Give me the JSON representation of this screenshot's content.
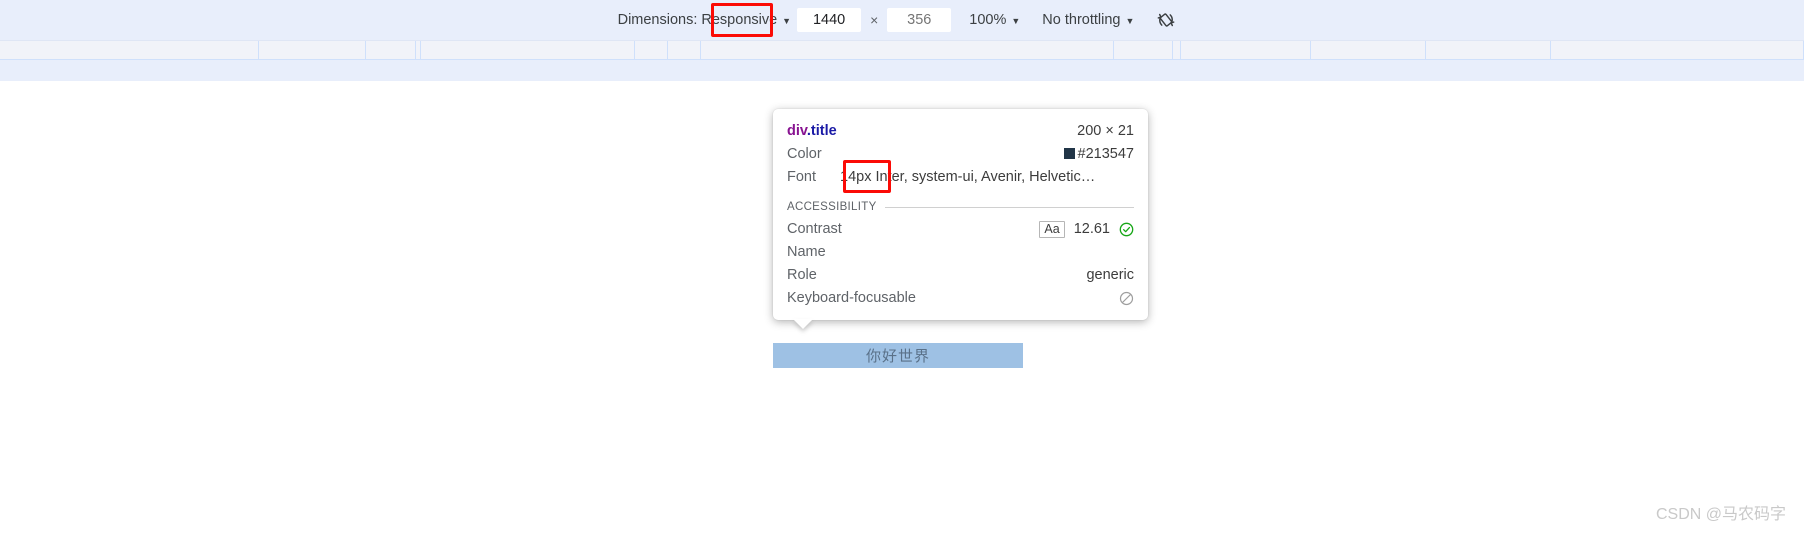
{
  "device_toolbar": {
    "dimensions_label": "Dimensions: Responsive",
    "width_value": "1440",
    "height_placeholder": "356",
    "multiply_symbol": "×",
    "zoom_label": "100%",
    "throttling_label": "No throttling",
    "rotate_icon": "rotate-device-icon",
    "caret_glyph": "▼"
  },
  "ruler": {
    "tick_positions": [
      258,
      365,
      415,
      420,
      634,
      667,
      700,
      1113,
      1172,
      1180,
      1310,
      1425,
      1550,
      1803
    ]
  },
  "inspector_tooltip": {
    "selector_tag": "div",
    "selector_class": ".title",
    "dimensions": "200 × 21",
    "color_label": "Color",
    "color_value": "#213547",
    "color_swatch_hex": "#213547",
    "font_label": "Font",
    "font_size": "14px",
    "font_value": "14px Inter, system-ui, Avenir, Helvetic…",
    "accessibility_title": "ACCESSIBILITY",
    "contrast_label": "Contrast",
    "contrast_badge": "Aa",
    "contrast_value": "12.61",
    "contrast_status_icon": "check-circle-icon",
    "name_label": "Name",
    "name_value": "",
    "role_label": "Role",
    "role_value": "generic",
    "keyboard_label": "Keyboard-focusable",
    "keyboard_status_icon": "not-allowed-icon"
  },
  "highlighted_element": {
    "text": "你好世界",
    "overlay_color": "#9ec1e4",
    "text_color": "#5a7189"
  },
  "annotations": {
    "width_box_color": "#fb0b06",
    "font_box_color": "#fb0b06"
  },
  "watermark": {
    "text": "CSDN @马农码字"
  }
}
